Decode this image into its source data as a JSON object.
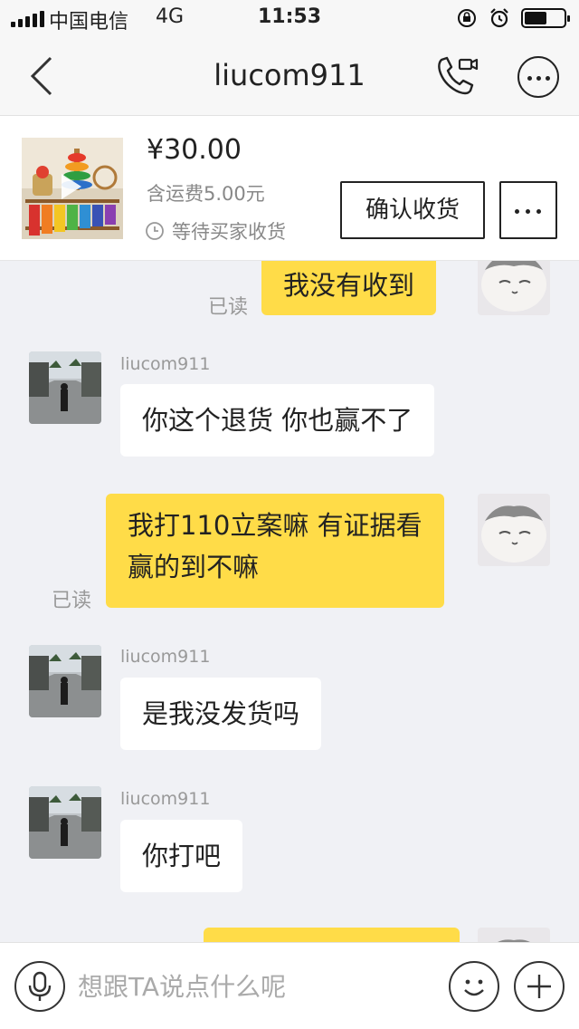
{
  "status_bar": {
    "carrier": "中国电信",
    "network": "4G",
    "time": "11:53",
    "icons": [
      "signal-icon",
      "rotation-lock-icon",
      "alarm-icon",
      "battery-icon"
    ]
  },
  "nav": {
    "title": "liucom911",
    "icons": [
      "back-icon",
      "phone-video-icon",
      "more-icon"
    ]
  },
  "order": {
    "price": "¥30.00",
    "shipping": "含运费5.00元",
    "status": "等待买家收货",
    "confirm_label": "确认收货",
    "icons": [
      "play-icon",
      "clock-icon",
      "more-icon"
    ]
  },
  "messages": [
    {
      "direction": "out",
      "text": "我没有收到",
      "read": "已读"
    },
    {
      "direction": "in",
      "sender": "liucom911",
      "text": "你这个退货 你也赢不了"
    },
    {
      "direction": "out",
      "lines": [
        "我打110立案嘛 有证据看",
        "赢的到不嘛"
      ],
      "read": "已读"
    },
    {
      "direction": "in",
      "sender": "liucom911",
      "text": "是我没发货吗"
    },
    {
      "direction": "in",
      "sender": "liucom911",
      "text": "你打吧"
    }
  ],
  "input": {
    "placeholder": "想跟TA说点什么呢",
    "icons": [
      "microphone-icon",
      "emoji-icon",
      "plus-icon"
    ]
  },
  "colors": {
    "outgoing_bubble": "#ffdc48",
    "incoming_bubble": "#ffffff",
    "chat_background": "#f0f1f5"
  }
}
